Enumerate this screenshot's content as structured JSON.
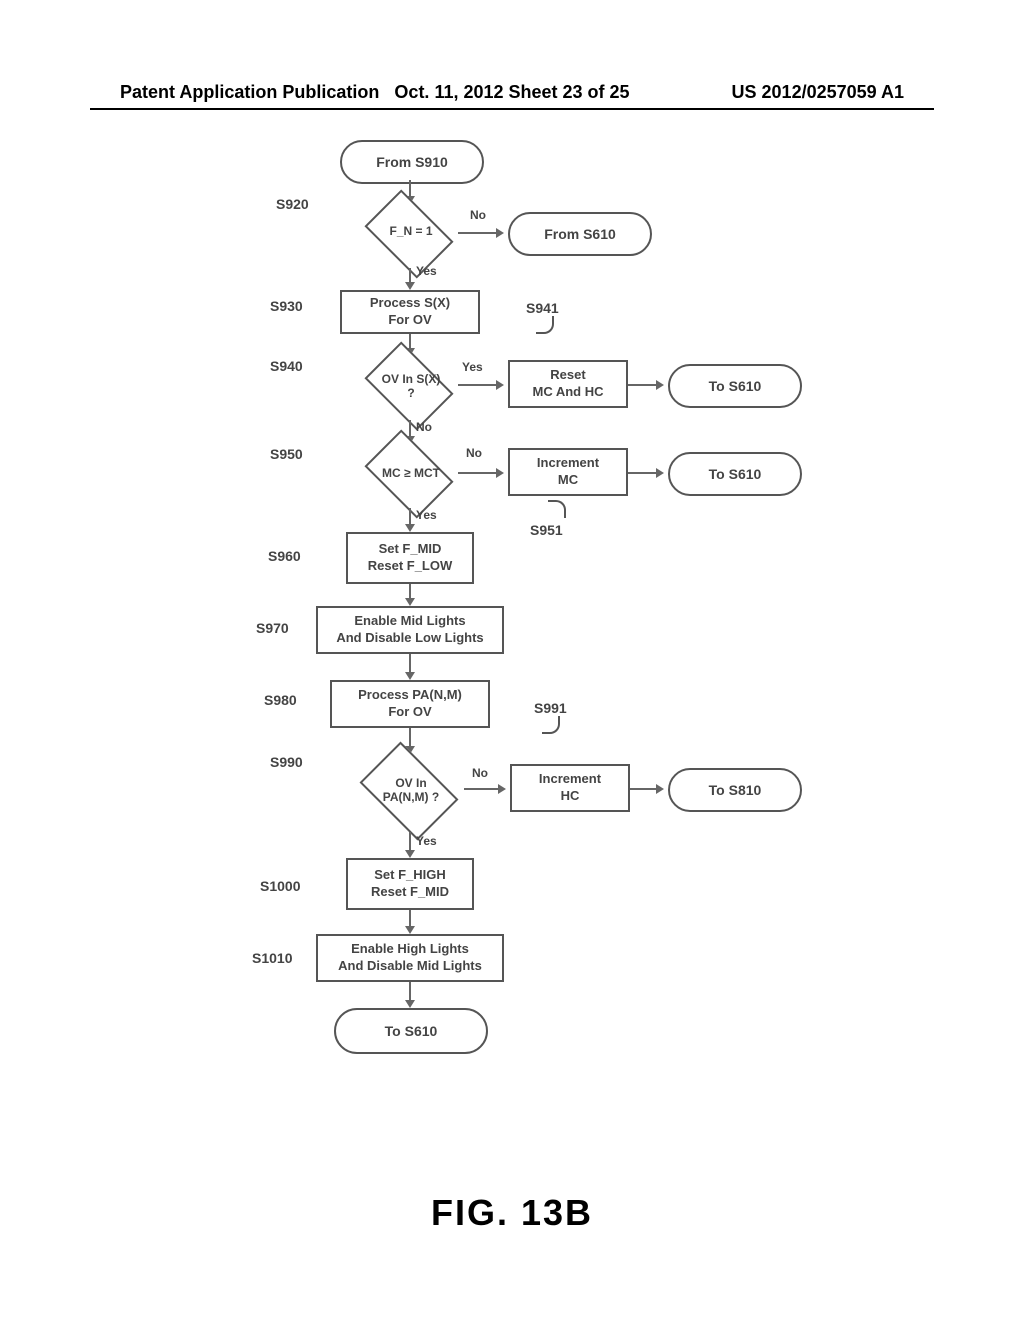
{
  "header": {
    "left": "Patent Application Publication",
    "center": "Oct. 11, 2012  Sheet 23 of 25",
    "right": "US 2012/0257059 A1"
  },
  "figure_label": "FIG. 13B",
  "nodes": {
    "from_s910": "From S910",
    "from_s610": "From S610",
    "to_s610_a": "To S610",
    "to_s610_b": "To S610",
    "to_s810": "To S810",
    "to_s610_end": "To S610",
    "s920_label": "S920",
    "s920_text": "F_N = 1",
    "s930_label": "S930",
    "s930_text": "Process S(X)\nFor OV",
    "s940_label": "S940",
    "s940_text": "OV In S(X)\n?",
    "s941_label": "S941",
    "s941_text": "Reset\nMC And HC",
    "s950_label": "S950",
    "s950_text": "MC ≥ MCT",
    "s951_label": "S951",
    "s951_text": "Increment\nMC",
    "s960_label": "S960",
    "s960_text": "Set F_MID\nReset F_LOW",
    "s970_label": "S970",
    "s970_text": "Enable Mid Lights\nAnd Disable Low Lights",
    "s980_label": "S980",
    "s980_text": "Process PA(N,M)\nFor OV",
    "s990_label": "S990",
    "s990_text": "OV In\nPA(N,M) ?",
    "s991_label": "S991",
    "s991_text": "Increment\nHC",
    "s1000_label": "S1000",
    "s1000_text": "Set F_HIGH\nReset F_MID",
    "s1010_label": "S1010",
    "s1010_text": "Enable High Lights\nAnd Disable Mid Lights"
  },
  "edges": {
    "yes": "Yes",
    "no": "No"
  }
}
